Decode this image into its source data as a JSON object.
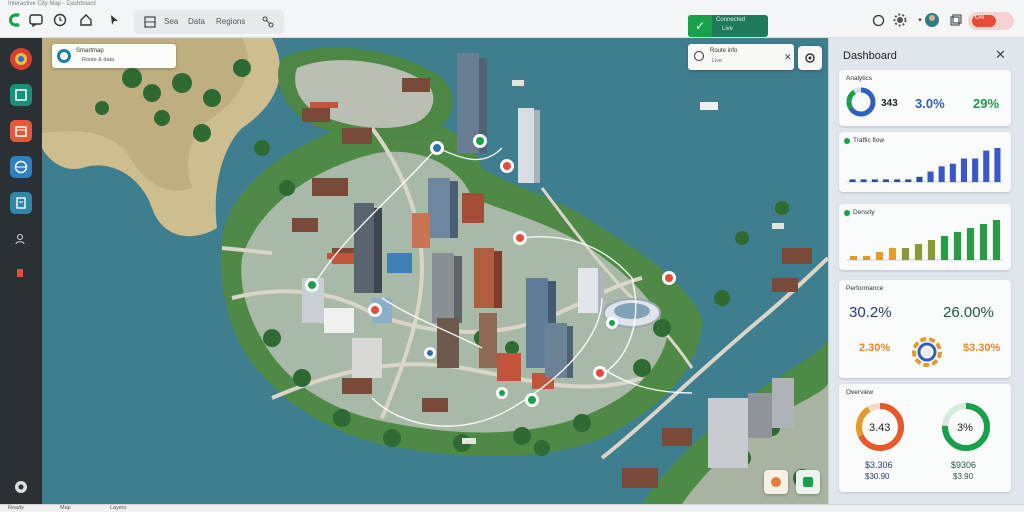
{
  "window": {
    "title": "Interactive City Map - Dashboard"
  },
  "toolbar": {
    "labels": [
      "Sea",
      "Data",
      "Regions"
    ],
    "center": {
      "line1": "Connected",
      "line2": "Live"
    },
    "toggle_label": "ON"
  },
  "map": {
    "legend": {
      "title": "Smartmap",
      "subtitle": "Route & data"
    },
    "status": {
      "title": "Route info",
      "subtitle": "Live"
    }
  },
  "panel": {
    "title": "Dashboard",
    "card1": {
      "header": "Analytics",
      "value_left": "343",
      "value_mid": "3.0%",
      "value_right": "29%"
    },
    "card2": {
      "header": "Traffic flow"
    },
    "card3": {
      "header": "Density"
    },
    "card4": {
      "header": "Performance",
      "value_left": "30.2%",
      "value_right": "26.00%",
      "value_left2": "2.30%",
      "value_right2": "$3.30%"
    },
    "card5": {
      "header": "Overview",
      "ring_left": "3.43",
      "ring_right": "3%",
      "left_value": "$3.306",
      "left_sub": "$30.90",
      "right_value": "$9306",
      "right_sub": "$3.90"
    }
  },
  "bottom": {
    "labels": [
      "Ready",
      "Map",
      "Layers"
    ]
  },
  "chart_data": [
    {
      "type": "bar",
      "series": [
        {
          "values": [
            1,
            1,
            1,
            1,
            1,
            1,
            2,
            4,
            6,
            7,
            9,
            9,
            12,
            13
          ]
        }
      ]
    },
    {
      "type": "bar",
      "series": [
        {
          "values": [
            1,
            1,
            2,
            3,
            3,
            4,
            5,
            6,
            7,
            8,
            9,
            10
          ]
        }
      ]
    }
  ],
  "colors": {
    "accent_green": "#18a04a",
    "accent_blue": "#2f5fbf",
    "accent_orange": "#e59b2c",
    "accent_red": "#e64c3b"
  }
}
